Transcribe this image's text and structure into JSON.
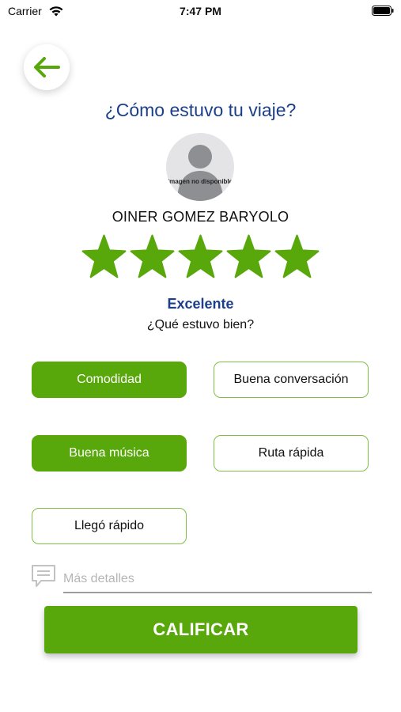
{
  "status_bar": {
    "carrier": "Carrier",
    "time": "7:47 PM"
  },
  "header": {
    "back_icon": "arrow-left-icon",
    "title": "¿Cómo estuvo tu viaje?"
  },
  "driver": {
    "avatar_placeholder": "Imagen no disponible",
    "name": "OINER GOMEZ BARYOLO"
  },
  "rating": {
    "stars": 5,
    "max": 5,
    "label": "Excelente"
  },
  "question": "¿Qué estuvo bien?",
  "options": [
    {
      "label": "Comodidad",
      "selected": true
    },
    {
      "label": "Buena conversación",
      "selected": false
    },
    {
      "label": "Buena música",
      "selected": true
    },
    {
      "label": "Ruta rápida",
      "selected": false
    },
    {
      "label": "Llegó rápido",
      "selected": false
    }
  ],
  "details": {
    "placeholder": "Más detalles",
    "value": ""
  },
  "submit_label": "CALIFICAR",
  "colors": {
    "accent": "#59a80b",
    "title": "#1c3f8b"
  }
}
